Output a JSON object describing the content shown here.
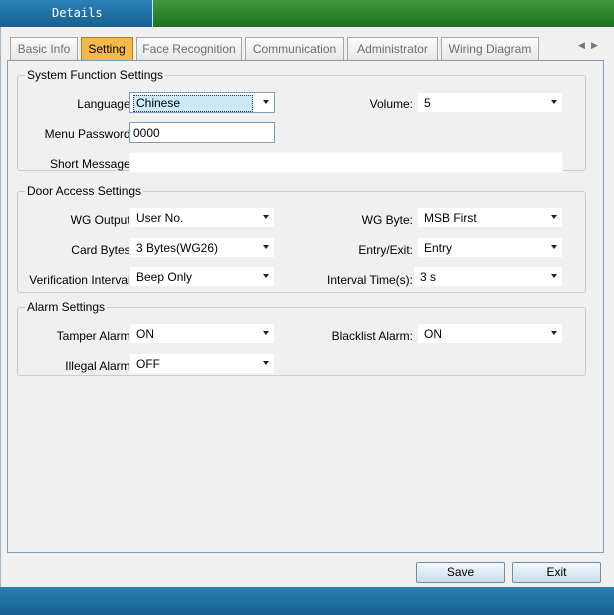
{
  "window": {
    "title": "Details"
  },
  "tabs": [
    {
      "label": "Basic Info",
      "active": false
    },
    {
      "label": "Setting",
      "active": true
    },
    {
      "label": "Face Recognition",
      "active": false
    },
    {
      "label": "Communication",
      "active": false
    },
    {
      "label": "Administrator",
      "active": false
    },
    {
      "label": "Wiring Diagram",
      "active": false
    }
  ],
  "system": {
    "legend": "System Function Settings",
    "language_label": "Language:",
    "language_value": "Chinese",
    "volume_label": "Volume:",
    "volume_value": "5",
    "menu_password_label": "Menu Password:",
    "menu_password_value": "0000",
    "short_message_label": "Short Message:",
    "short_message_value": ""
  },
  "door": {
    "legend": "Door Access Settings",
    "wg_output_label": "WG Output:",
    "wg_output_value": "User No.",
    "wg_byte_label": "WG Byte:",
    "wg_byte_value": "MSB First",
    "card_bytes_label": "Card Bytes:",
    "card_bytes_value": "3 Bytes(WG26)",
    "entry_exit_label": "Entry/Exit:",
    "entry_exit_value": "Entry",
    "verification_label": "Verification Interval:",
    "verification_value": "Beep Only",
    "interval_time_label": "Interval Time(s):",
    "interval_time_value": "3 s"
  },
  "alarm": {
    "legend": "Alarm Settings",
    "tamper_label": "Tamper Alarm:",
    "tamper_value": "ON",
    "blacklist_label": "Blacklist Alarm:",
    "blacklist_value": "ON",
    "illegal_label": "Illegal Alarm:",
    "illegal_value": "OFF"
  },
  "buttons": {
    "save": "Save",
    "exit": "Exit"
  }
}
